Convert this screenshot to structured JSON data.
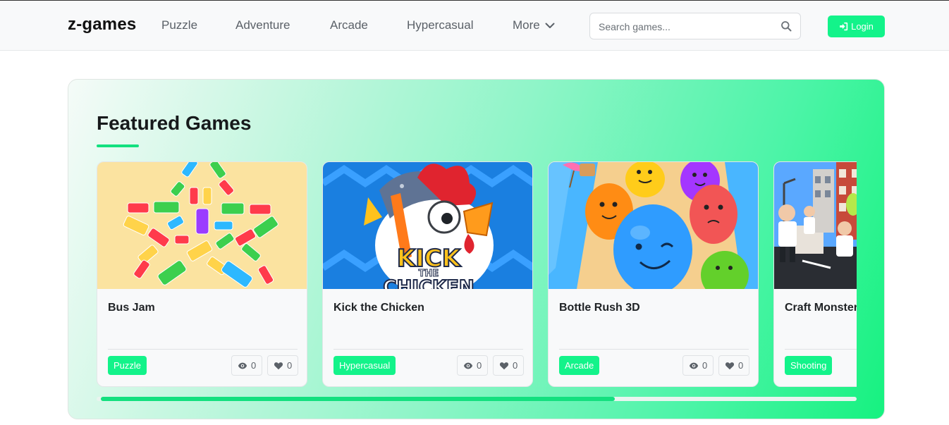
{
  "header": {
    "brand": "z-games",
    "nav": [
      {
        "label": "Puzzle"
      },
      {
        "label": "Adventure"
      },
      {
        "label": "Arcade"
      },
      {
        "label": "Hypercasual"
      },
      {
        "label": "More",
        "icon": "chevron-down-icon"
      }
    ],
    "search": {
      "placeholder": "Search games...",
      "value": "",
      "icon": "search-icon"
    },
    "login": {
      "label": "Login",
      "icon": "sign-in-icon"
    }
  },
  "featured": {
    "title": "Featured Games",
    "games": [
      {
        "title": "Bus Jam",
        "tag": "Puzzle",
        "views": "0",
        "likes": "0",
        "thumbnail": "bus-jam-thumbnail"
      },
      {
        "title": "Kick the Chicken",
        "tag": "Hypercasual",
        "views": "0",
        "likes": "0",
        "thumbnail": "kick-the-chicken-thumbnail",
        "thumbnail_text": [
          "KICK",
          "THE",
          "CHICKEN"
        ]
      },
      {
        "title": "Bottle Rush 3D",
        "tag": "Arcade",
        "views": "0",
        "likes": "0",
        "thumbnail": "bottle-rush-3d-thumbnail"
      },
      {
        "title": "Craft Monster",
        "tag": "Shooting",
        "thumbnail": "craft-monster-thumbnail"
      }
    ],
    "scroll_progress": 0.68
  },
  "colors": {
    "accent": "#13f38a",
    "underline": "#13e07f",
    "panel_gradient_start": "#f5fbf8",
    "panel_gradient_end": "#16f280"
  }
}
